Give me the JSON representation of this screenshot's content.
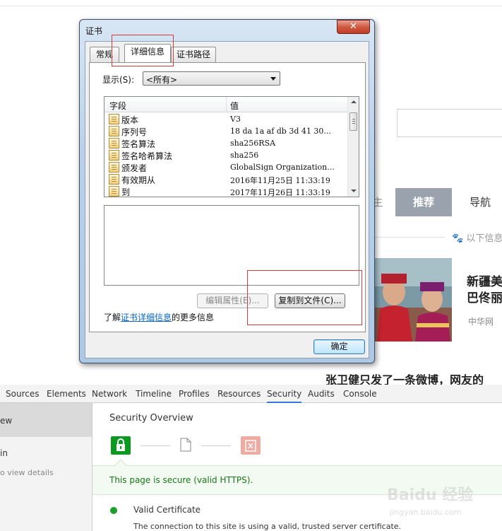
{
  "webpage": {
    "nav": {
      "left_fragment": "主",
      "recommend": "推荐",
      "navigate": "导航"
    },
    "info_tag": "以下信息",
    "news1": {
      "title_line1": "新疆美",
      "title_line2": "巴佟丽",
      "source": "中华网"
    },
    "news2_title": "张卫健只发了一条微博，网友的"
  },
  "devtools": {
    "tabs": [
      "Sources",
      "Elements",
      "Network",
      "Timeline",
      "Profiles",
      "Resources",
      "Security",
      "Audits",
      "Console"
    ],
    "active_tab": "Security",
    "sidebar": {
      "selected_fragment": "ew",
      "origin_fragment": "in",
      "hint_fragment": "o view details"
    },
    "security": {
      "title": "Security Overview",
      "banner": "This page is secure (valid HTTPS).",
      "cert_title": "Valid Certificate",
      "cert_desc": "The connection to this site is using a valid, trusted server certificate.",
      "colors": {
        "secure": "#0a9a1f",
        "insecure": "#f0aaa2"
      }
    }
  },
  "dialog": {
    "title": "证书",
    "close_glyph": "✕",
    "tabs": {
      "general": "常规",
      "details": "详细信息",
      "path": "证书路径"
    },
    "show_label": "显示(S):",
    "show_value": "<所有>",
    "list": {
      "col_field": "字段",
      "col_value": "值",
      "rows": [
        {
          "field": "版本",
          "value": "V3"
        },
        {
          "field": "序列号",
          "value": "18 da 1a af db 3d 41 30..."
        },
        {
          "field": "签名算法",
          "value": "sha256RSA"
        },
        {
          "field": "签名哈希算法",
          "value": "sha256"
        },
        {
          "field": "颁发者",
          "value": "GlobalSign Organization..."
        },
        {
          "field": "有效期从",
          "value": "2016年11月25日 11:33:19"
        },
        {
          "field": "到",
          "value": "2017年11月26日 11:33:19"
        }
      ]
    },
    "edit_button": "编辑属性(E)...",
    "copy_button": "复制到文件(C)...",
    "learn_prefix": "了解",
    "learn_link": "证书详细信息",
    "learn_suffix": "的更多信息",
    "ok_button": "确定"
  },
  "watermark": {
    "brand": "Baidu 经验",
    "url": "jingyan.baidu.com"
  }
}
